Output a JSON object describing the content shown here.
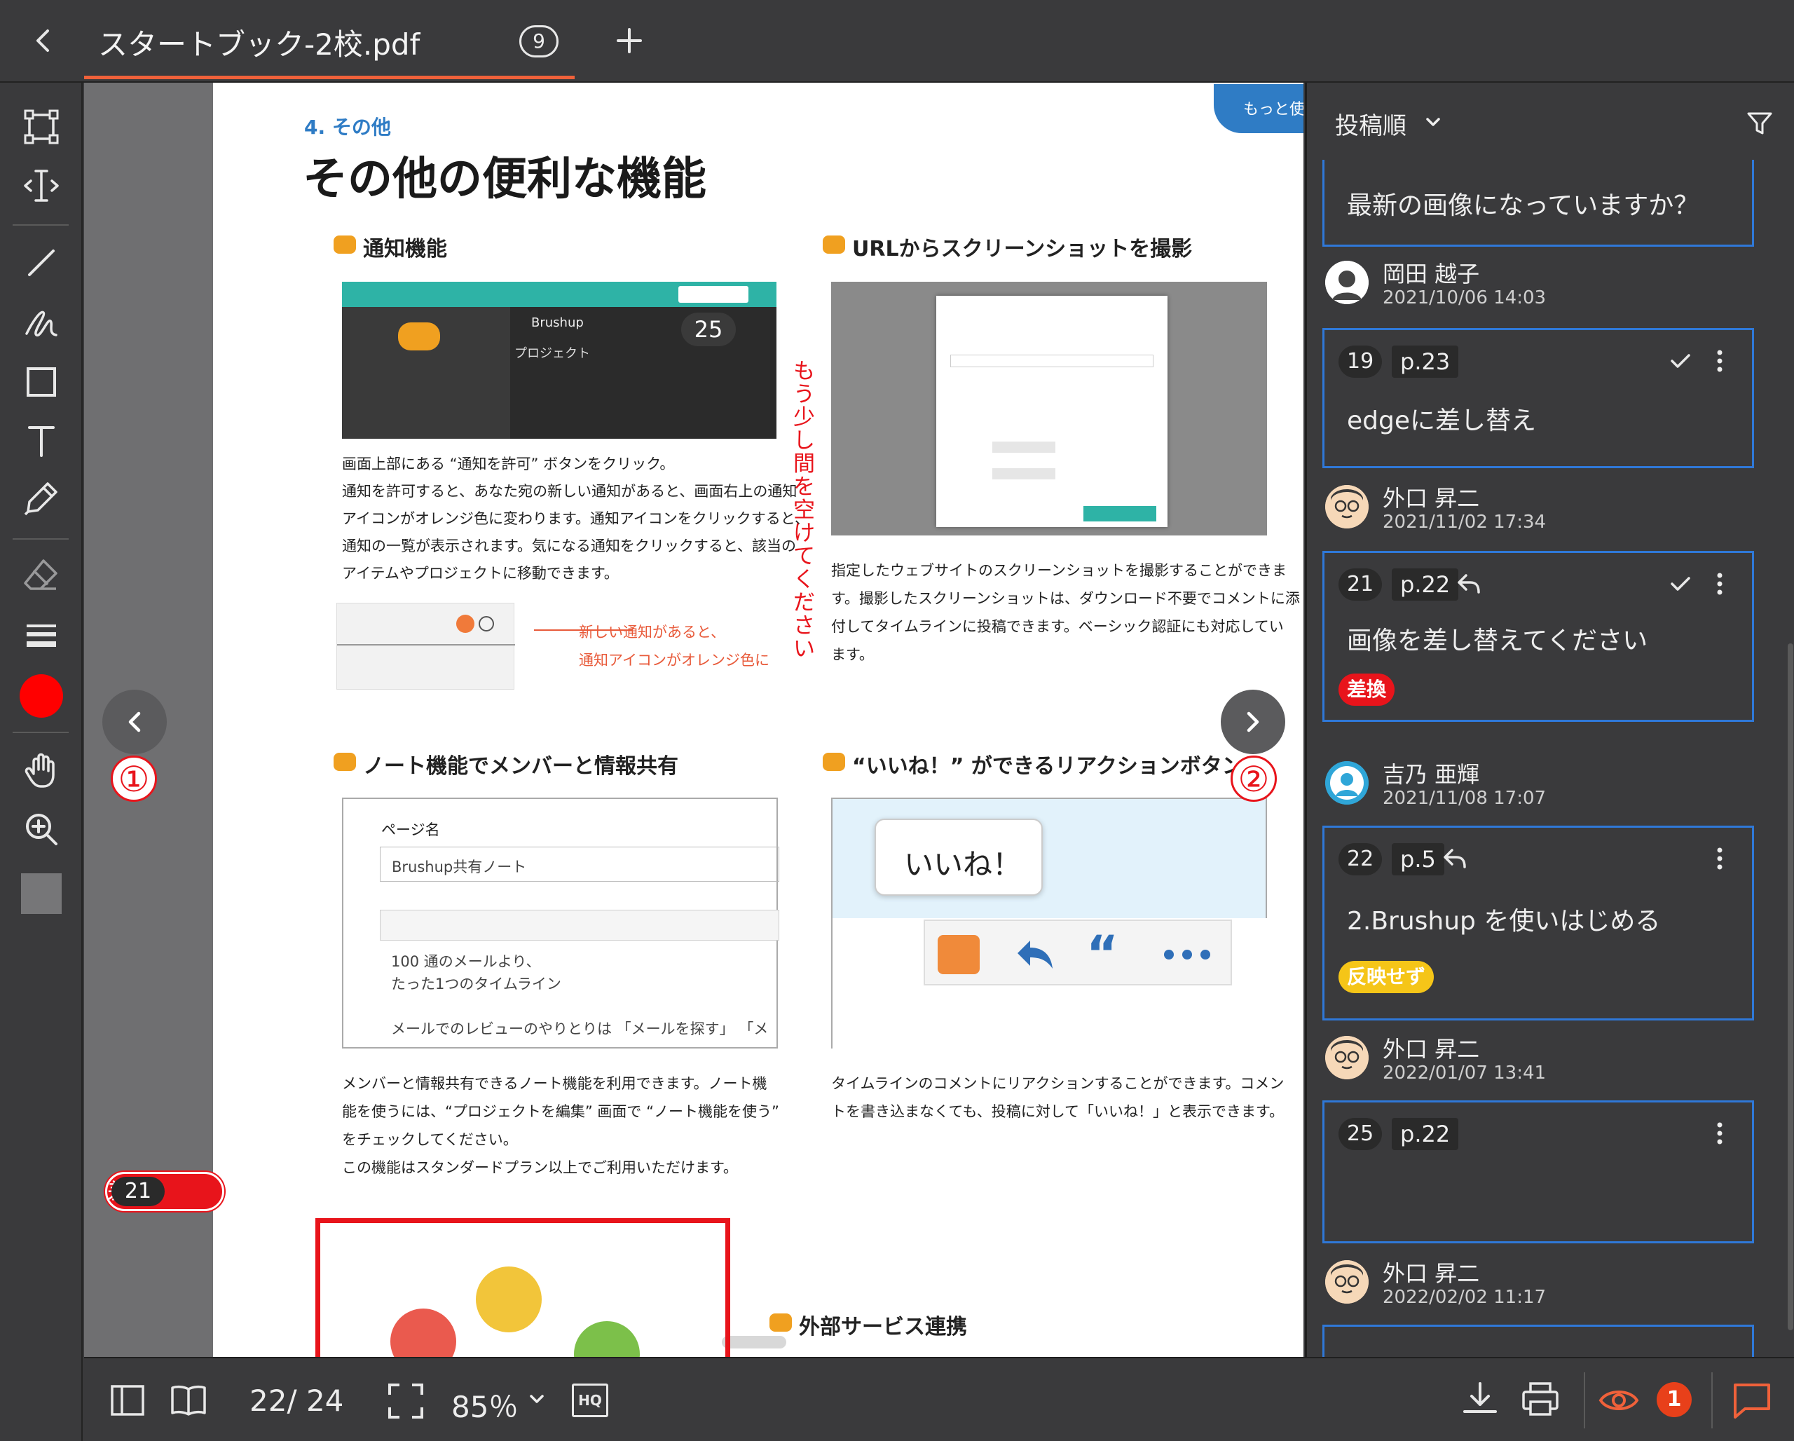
{
  "header": {
    "back_icon": "chevron-left-icon",
    "file_name": "スタートブック-2校.pdf",
    "file_count": "9",
    "add_tab_icon": "plus-icon"
  },
  "toolbar": {
    "tools": [
      "rectangle-select-icon",
      "text-cursor-icon",
      "line-icon",
      "freehand-icon",
      "rectangle-icon",
      "text-icon",
      "marker-icon",
      "eraser-icon",
      "line-weight-icon",
      "color-swatch-icon",
      "hand-icon",
      "zoom-in-icon",
      "fill-swatch-icon"
    ],
    "color": "#ff0000"
  },
  "document": {
    "ribbon": "もっと使いこなす",
    "section_label": "4. その他",
    "main_title": "その他の便利な機能",
    "sections": {
      "notify": {
        "title": "通知機能",
        "lines": [
          "画面上部にある “通知を許可” ボタンをクリック。",
          "通知を許可すると、あなた宛の新しい通知があると、画面右上の通知",
          "アイコンがオレンジ色に変わります。通知アイコンをクリックすると、",
          "通知の一覧が表示されます。気になる通知をクリックすると、該当の",
          "アイテムやプロジェクトに移動できます。"
        ],
        "callout_1": "新しい通知があると、",
        "callout_2": "通知アイコンがオレンジ色に",
        "shot_project": "プロジェクト",
        "shot_brand": "Brushup"
      },
      "url": {
        "title": "URLからスクリーンショットを撮影",
        "lines": [
          "指定したウェブサイトのスクリーンショットを撮影することができま",
          "す。撮影したスクリーンショットは、ダウンロード不要でコメントに添",
          "付してタイムラインに投稿できます。ベーシック認証にも対応してい",
          "ます。"
        ]
      },
      "note": {
        "title": "ノート機能でメンバーと情報共有",
        "field_label": "ページ名",
        "field_value": "Brushup共有ノート",
        "body_1": "100 通のメールより、",
        "body_2": "たった1つのタイムライン",
        "body_3": "メールでのレビューのやりとりは 「メールを探す」 「メ",
        "lines": [
          "メンバーと情報共有できるノート機能を利用できます。ノート機",
          "能を使うには、“プロジェクトを編集” 画面で “ノート機能を使う”",
          "をチェックしてください。",
          "この機能はスタンダードプラン以上でご利用いただけます。"
        ]
      },
      "reaction": {
        "title": "“いいね！” ができるリアクションボタン",
        "bubble": "いいね！",
        "lines": [
          "タイムラインのコメントにリアクションすることができます。コメン",
          "トを書き込まなくても、投稿に対して「いいね！」と表示できます。"
        ]
      },
      "external": {
        "title": "外部サービス連携"
      }
    },
    "annotations": {
      "pin_25": "25",
      "vertical_note": "もう少し間を空けてください",
      "pin_21_num": "21",
      "pin_21_tag": "差換"
    },
    "nav": {
      "prev_marker": "①",
      "next_marker": "②"
    }
  },
  "panel": {
    "sort_label": "投稿順",
    "filter_icon": "filter-icon",
    "top_card_text": "最新の画像になっていますか？",
    "comments": [
      {
        "author": "岡田 越子",
        "date": "2021/10/06 14:03",
        "num": "19",
        "page": "p.23",
        "text": "edgeに差し替え",
        "tag": "",
        "resolved": true
      },
      {
        "author": "外口 昇二",
        "date": "2021/11/02 17:34",
        "num": "21",
        "page": "p.22",
        "text": "画像を差し替えてください",
        "tag": "差換",
        "resolved": true
      },
      {
        "author": "吉乃 亜輝",
        "date": "2021/11/08 17:07",
        "num": "22",
        "page": "p.5",
        "text": "2.Brushup を使いはじめる",
        "tag": "反映せず",
        "resolved": false
      },
      {
        "author": "外口 昇二",
        "date": "2022/01/07 13:41",
        "num": "25",
        "page": "p.22",
        "text": "",
        "tag": "",
        "resolved": false
      },
      {
        "author": "外口 昇二",
        "date": "2022/02/02 11:17"
      }
    ]
  },
  "footer": {
    "page_indicator": "22/ 24",
    "zoom": "85％",
    "hq_label": "HQ",
    "notification_count": "1",
    "colors": {
      "accent": "#f0613a",
      "badge": "#e8401a",
      "highlight": "#2f78d8"
    }
  }
}
